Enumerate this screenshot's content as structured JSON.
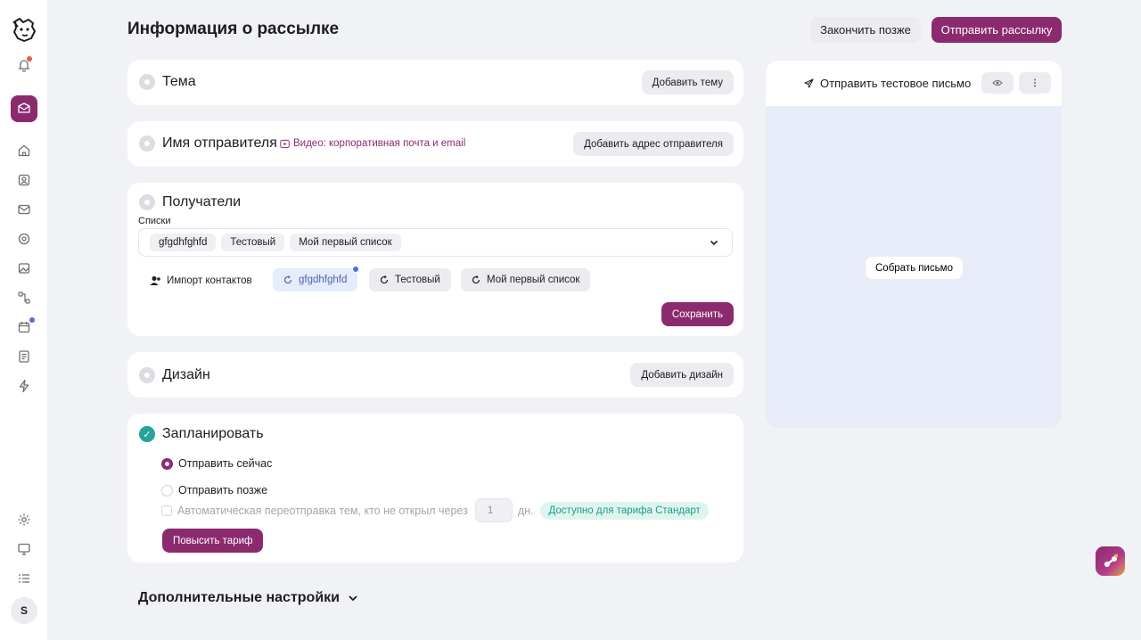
{
  "header": {
    "title": "Информация о рассылке",
    "finish_later": "Закончить позже",
    "send_campaign": "Отправить рассылку"
  },
  "sidebar": {
    "user_initial": "S",
    "items": [
      "bell-icon",
      "mail-active-icon",
      "home-icon",
      "contacts-icon",
      "envelope-icon",
      "target-icon",
      "image-icon",
      "flow-icon",
      "calendar-icon",
      "document-icon",
      "lightning-icon",
      "settings-icon",
      "monitor-icon",
      "list-icon"
    ]
  },
  "subject": {
    "title": "Тема",
    "add_button": "Добавить тему"
  },
  "sender": {
    "title": "Имя отправителя",
    "video_link": "Видео: корпоративная почта и email",
    "add_button": "Добавить адрес отправителя"
  },
  "recipients": {
    "title": "Получатели",
    "lists_label": "Списки",
    "selected_chips": [
      "gfgdhfghfd",
      "Тестовый",
      "Мой первый список"
    ],
    "import_label": "Импорт контактов",
    "list_buttons": [
      "gfgdhfghfd",
      "Тестовый",
      "Мой первый список"
    ],
    "save_button": "Сохранить"
  },
  "design": {
    "title": "Дизайн",
    "add_button": "Добавить дизайн"
  },
  "schedule": {
    "title": "Запланировать",
    "send_now": "Отправить сейчас",
    "send_later": "Отправить позже",
    "auto_resend": "Автоматическая переотправка тем, кто не открыл через",
    "days_value": "1",
    "days_unit": "дн.",
    "plan_badge": "Доступно для тарифа Стандарт",
    "upgrade_button": "Повысить тариф"
  },
  "extra_settings": "Дополнительные настройки",
  "preview": {
    "send_test": "Отправить тестовое письмо",
    "build_letter": "Собрать письмо"
  },
  "colors": {
    "accent": "#8c2a6f",
    "success": "#27a399",
    "info": "#4a6cf0",
    "preview_bg": "#e8ebf8"
  }
}
